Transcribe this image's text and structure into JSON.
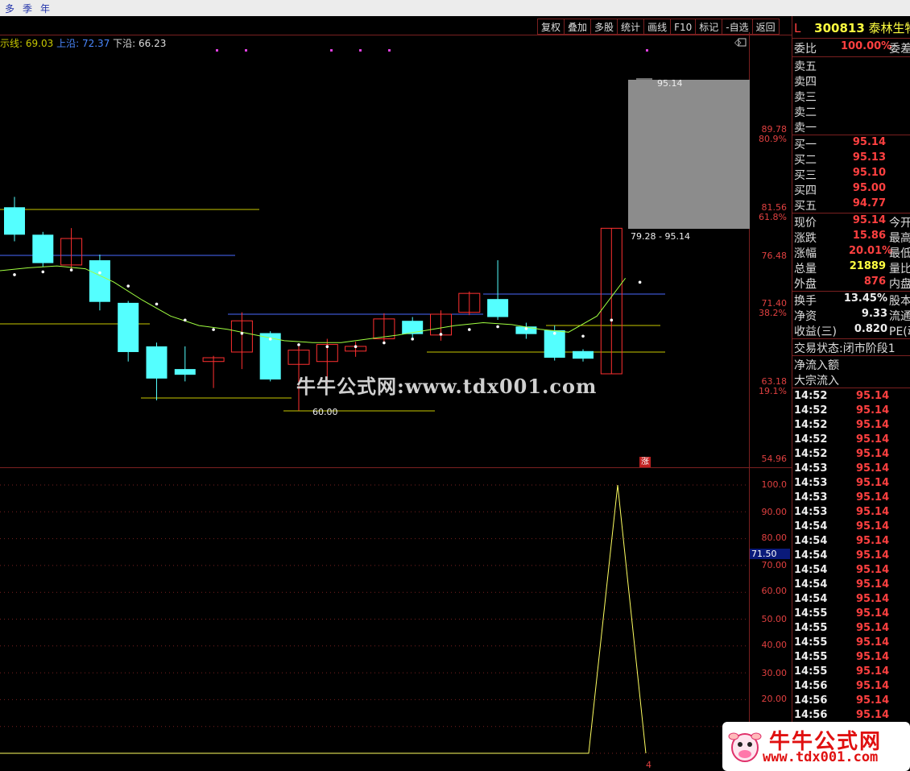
{
  "menu": [
    "多",
    "季",
    "年"
  ],
  "toolbar": [
    "复权",
    "叠加",
    "多股",
    "统计",
    "画线",
    "F10",
    "标记",
    "-自选",
    "返回"
  ],
  "legend": {
    "name": "示线",
    "value": "69.03",
    "upper_label": "上沿",
    "upper_value": "72.37",
    "lower_label": "下沿",
    "lower_value": "66.23"
  },
  "price_axis": [
    "89.78",
    "81.56",
    "76.48",
    "71.40",
    "63.18",
    "54.96"
  ],
  "pct_axis": [
    "80.9%",
    "61.8%",
    "38.2%",
    "19.1%"
  ],
  "annotations": {
    "high_marker": "95.14",
    "range": "79.28 - 95.14",
    "low_marker": "60.00"
  },
  "zhang_badge": "涨",
  "indicator_axis": [
    "100.0",
    "90.00",
    "80.00",
    "70.00",
    "60.00",
    "50.00",
    "40.00",
    "30.00",
    "20.00"
  ],
  "indicator_current": "71.50",
  "indicator_bottom": "4",
  "watermark": "牛牛公式网:www.tdx001.com",
  "logo": {
    "line1": "牛牛公式网",
    "line2": "www.tdx001.com"
  },
  "stock": {
    "market": "L",
    "code": "300813",
    "name": "泰林生物"
  },
  "weibi": {
    "label": "委比",
    "value": "100.00%",
    "label2": "委差"
  },
  "sell": [
    "卖五",
    "卖四",
    "卖三",
    "卖二",
    "卖一"
  ],
  "buy": [
    {
      "label": "买一",
      "price": "95.14"
    },
    {
      "label": "买二",
      "price": "95.13"
    },
    {
      "label": "买三",
      "price": "95.10"
    },
    {
      "label": "买四",
      "price": "95.00"
    },
    {
      "label": "买五",
      "price": "94.77"
    }
  ],
  "quote": [
    {
      "label": "现价",
      "value": "95.14",
      "label2": "今开"
    },
    {
      "label": "涨跌",
      "value": "15.86",
      "label2": "最高"
    },
    {
      "label": "涨幅",
      "value": "20.01%",
      "label2": "最低"
    },
    {
      "label": "总量",
      "value": "21889",
      "label2": "量比"
    },
    {
      "label": "外盘",
      "value": "876",
      "label2": "内盘"
    }
  ],
  "fund": [
    {
      "label": "换手",
      "value": "13.45%",
      "label2": "股本"
    },
    {
      "label": "净资",
      "value": "9.33",
      "label2": "流通"
    },
    {
      "label": "收益(三)",
      "value": "0.820",
      "label2": "PE(动"
    }
  ],
  "status": {
    "label": "交易状态:",
    "value": "闭市阶段",
    "extra": "1"
  },
  "flows": [
    "净流入额",
    "大宗流入"
  ],
  "ticks": [
    {
      "time": "14:52",
      "price": "95.14"
    },
    {
      "time": "14:52",
      "price": "95.14"
    },
    {
      "time": "14:52",
      "price": "95.14"
    },
    {
      "time": "14:52",
      "price": "95.14"
    },
    {
      "time": "14:52",
      "price": "95.14"
    },
    {
      "time": "14:53",
      "price": "95.14"
    },
    {
      "time": "14:53",
      "price": "95.14"
    },
    {
      "time": "14:53",
      "price": "95.14"
    },
    {
      "time": "14:53",
      "price": "95.14"
    },
    {
      "time": "14:54",
      "price": "95.14"
    },
    {
      "time": "14:54",
      "price": "95.14"
    },
    {
      "time": "14:54",
      "price": "95.14"
    },
    {
      "time": "14:54",
      "price": "95.14"
    },
    {
      "time": "14:54",
      "price": "95.14"
    },
    {
      "time": "14:54",
      "price": "95.14"
    },
    {
      "time": "14:55",
      "price": "95.14"
    },
    {
      "time": "14:55",
      "price": "95.14"
    },
    {
      "time": "14:55",
      "price": "95.14"
    },
    {
      "time": "14:55",
      "price": "95.14"
    },
    {
      "time": "14:55",
      "price": "95.14"
    },
    {
      "time": "14:56",
      "price": "95.14"
    },
    {
      "time": "14:56",
      "price": "95.14"
    },
    {
      "time": "14:56",
      "price": "95.14"
    }
  ],
  "colors": {
    "up": "#ff3030",
    "down": "#54ffff",
    "ma": "#a0ff40",
    "bg": "#000000",
    "grid": "#7a2020"
  },
  "chart_data": {
    "type": "candlestick",
    "price_range": [
      54.96,
      95.14
    ],
    "candles": [
      {
        "o": 81.5,
        "c": 78.6,
        "h": 82.6,
        "l": 77.9
      },
      {
        "o": 78.6,
        "c": 75.6,
        "h": 78.9,
        "l": 75.2
      },
      {
        "o": 75.4,
        "c": 78.2,
        "h": 79.3,
        "l": 74.9
      },
      {
        "o": 75.9,
        "c": 71.5,
        "h": 76.5,
        "l": 70.6
      },
      {
        "o": 71.4,
        "c": 66.2,
        "h": 71.6,
        "l": 65.2
      },
      {
        "o": 66.8,
        "c": 63.4,
        "h": 67.2,
        "l": 61.1
      },
      {
        "o": 64.4,
        "c": 63.8,
        "h": 66.8,
        "l": 63.1
      },
      {
        "o": 65.2,
        "c": 65.6,
        "h": 65.8,
        "l": 62.4
      },
      {
        "o": 66.2,
        "c": 69.5,
        "h": 70.4,
        "l": 64.4
      },
      {
        "o": 68.2,
        "c": 63.3,
        "h": 68.4,
        "l": 63.1
      },
      {
        "o": 64.9,
        "c": 66.4,
        "h": 66.8,
        "l": 60.0
      },
      {
        "o": 65.2,
        "c": 67.0,
        "h": 67.6,
        "l": 62.8
      },
      {
        "o": 66.3,
        "c": 66.8,
        "h": 67.3,
        "l": 65.7
      },
      {
        "o": 67.6,
        "c": 69.7,
        "h": 70.3,
        "l": 67.3
      },
      {
        "o": 69.5,
        "c": 68.1,
        "h": 69.9,
        "l": 67.6
      },
      {
        "o": 68.0,
        "c": 70.2,
        "h": 70.6,
        "l": 67.4
      },
      {
        "o": 70.4,
        "c": 72.4,
        "h": 72.6,
        "l": 70.1
      },
      {
        "o": 71.8,
        "c": 69.9,
        "h": 75.9,
        "l": 69.6
      },
      {
        "o": 68.9,
        "c": 68.1,
        "h": 69.3,
        "l": 67.6
      },
      {
        "o": 68.5,
        "c": 65.6,
        "h": 69.0,
        "l": 65.3
      },
      {
        "o": 66.3,
        "c": 65.5,
        "h": 66.5,
        "l": 65.2
      },
      {
        "o": 63.9,
        "c": 79.28,
        "h": 79.28,
        "l": 63.9
      }
    ],
    "ma": [
      74.8,
      75.1,
      75.3,
      75.0,
      73.6,
      71.7,
      70.0,
      69.0,
      68.6,
      68.0,
      67.4,
      67.2,
      67.2,
      67.6,
      68.0,
      68.5,
      69.0,
      69.3,
      69.1,
      68.6,
      68.3,
      70.0,
      74.0
    ],
    "indicator": {
      "range": [
        0,
        100
      ],
      "values": [
        0,
        0,
        0,
        0,
        0,
        0,
        0,
        0,
        0,
        0,
        0,
        0,
        0,
        0,
        0,
        0,
        0,
        0,
        0,
        0,
        0,
        100,
        0
      ]
    }
  }
}
